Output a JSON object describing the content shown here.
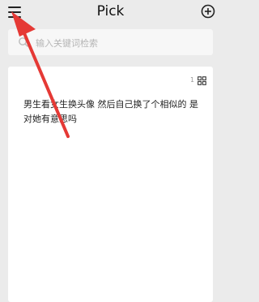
{
  "header": {
    "title": "Pick"
  },
  "search": {
    "placeholder": "输入关键词检索"
  },
  "note": {
    "count": "1",
    "text": "男生看女生换头像 然后自己换了个相似的 是对她有意思吗"
  },
  "icons": {
    "menu": "hamburger-menu-icon",
    "add": "plus-circle-icon",
    "search": "search-icon",
    "view": "grid-icon"
  },
  "colors": {
    "annotation_arrow": "#e53935",
    "background": "#ebebeb"
  }
}
